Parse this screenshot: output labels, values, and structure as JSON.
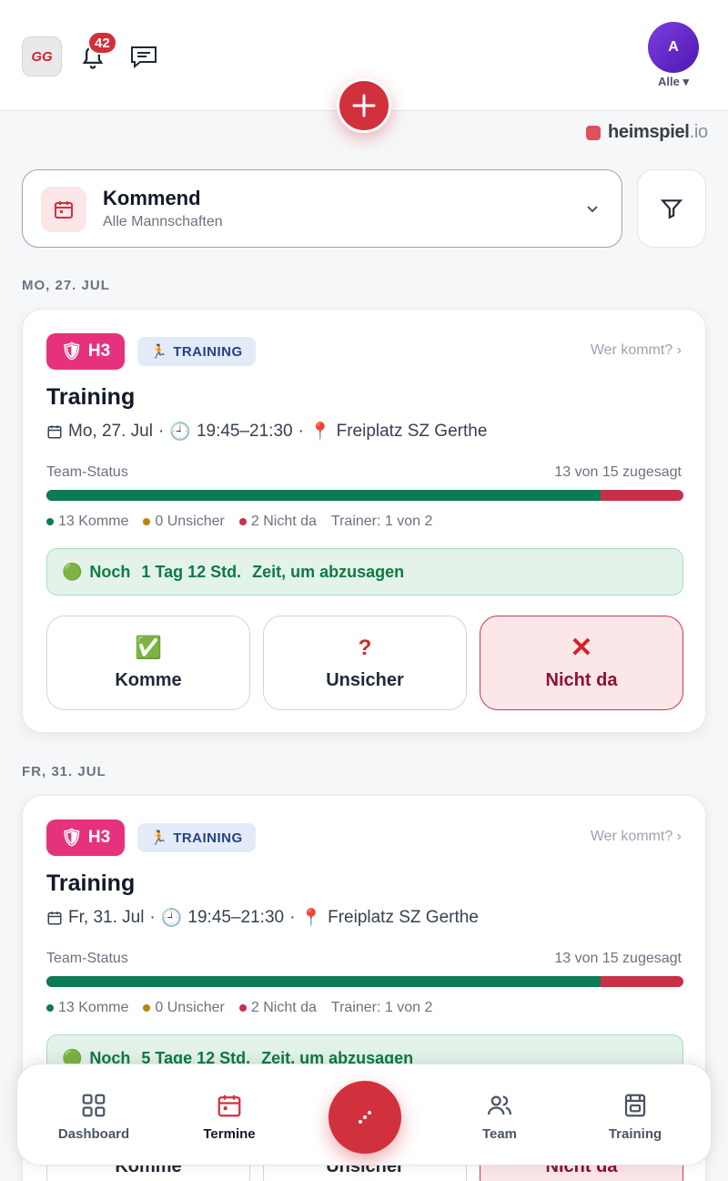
{
  "header": {
    "logo_text": "GG",
    "notifications_count": "42",
    "avatar_initial": "A",
    "avatar_label": "Alle ▾"
  },
  "brand": {
    "name": "heimspiel",
    "suffix": ".io"
  },
  "selector": {
    "title": "Kommend",
    "subtitle": "Alle Mannschaften"
  },
  "events": [
    {
      "date_header": "MO, 27. JUL",
      "team": "H3",
      "type": "TRAINING",
      "who_link": "Wer kommt? ›",
      "title": "Training",
      "date": "Mo, 27. Jul",
      "time": "19:45–21:30",
      "location": "Freiplatz SZ Gerthe",
      "status_label": "Team-Status",
      "status_summary": "13 von 15 zugesagt",
      "progress_yes_fraction": 0.87,
      "legend_yes": "13 Komme",
      "legend_maybe": "0 Unsicher",
      "legend_no": "2 Nicht da",
      "legend_trainer": "Trainer: 1 von 2",
      "deadline_prefix": "Noch",
      "deadline_time": "1 Tag 12 Std.",
      "deadline_suffix": "Zeit, um abzusagen",
      "btn_yes": "Komme",
      "btn_maybe": "Unsicher",
      "btn_no": "Nicht da"
    },
    {
      "date_header": "FR, 31. JUL",
      "team": "H3",
      "type": "TRAINING",
      "who_link": "Wer kommt? ›",
      "title": "Training",
      "date": "Fr, 31. Jul",
      "time": "19:45–21:30",
      "location": "Freiplatz SZ Gerthe",
      "status_label": "Team-Status",
      "status_summary": "13 von 15 zugesagt",
      "progress_yes_fraction": 0.87,
      "legend_yes": "13 Komme",
      "legend_maybe": "0 Unsicher",
      "legend_no": "2 Nicht da",
      "legend_trainer": "Trainer: 1 von 2",
      "deadline_prefix": "Noch",
      "deadline_time": "5 Tage 12 Std.",
      "deadline_suffix": "Zeit, um abzusagen",
      "btn_yes": "Komme",
      "btn_maybe": "Unsicher",
      "btn_no": "Nicht da"
    }
  ],
  "nav": {
    "dashboard": "Dashboard",
    "termine": "Termine",
    "team": "Team",
    "training": "Training"
  },
  "colors": {
    "accent": "#d1313c",
    "team_pill": "#e6327d",
    "yes": "#0c7a53",
    "maybe": "#b8860b",
    "no": "#c8304a"
  }
}
